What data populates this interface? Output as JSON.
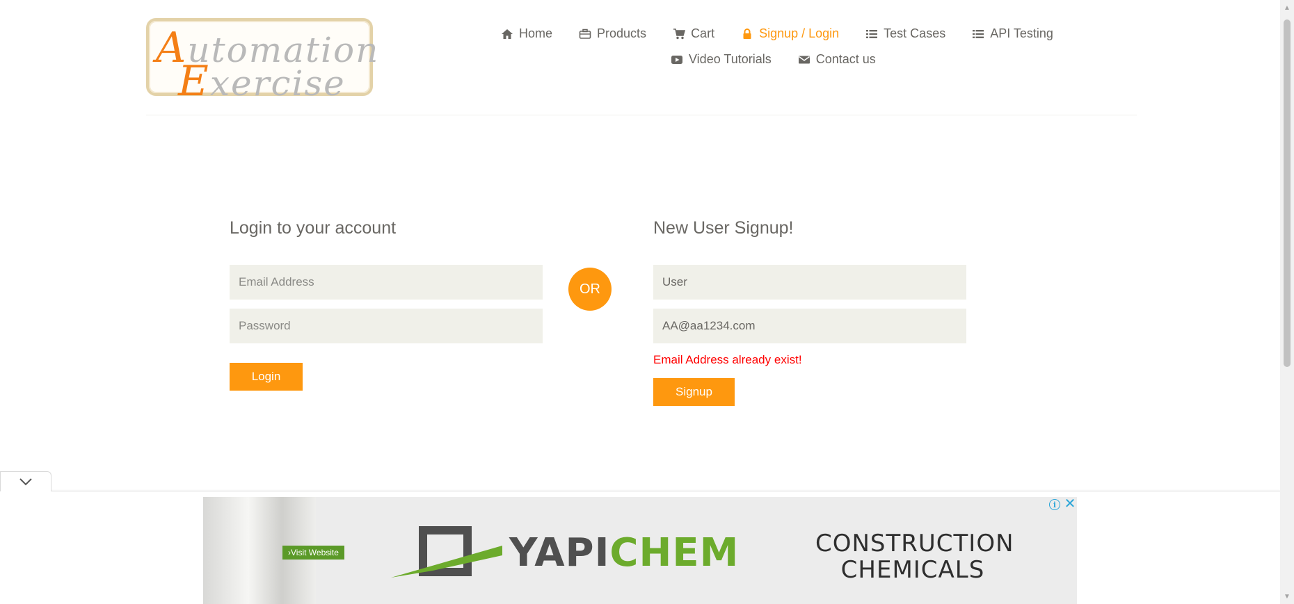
{
  "logo": {
    "line1_cap": "A",
    "line1_rest": "utomation",
    "line2_cap": "E",
    "line2_rest": "xercise"
  },
  "nav": {
    "row1": [
      {
        "label": "Home",
        "icon": "home-icon"
      },
      {
        "label": "Products",
        "icon": "briefcase-icon"
      },
      {
        "label": "Cart",
        "icon": "cart-icon"
      },
      {
        "label": "Signup / Login",
        "icon": "lock-icon",
        "active": true
      },
      {
        "label": "Test Cases",
        "icon": "list-icon"
      },
      {
        "label": "API Testing",
        "icon": "list-icon"
      }
    ],
    "row2": [
      {
        "label": "Video Tutorials",
        "icon": "youtube-icon"
      },
      {
        "label": "Contact us",
        "icon": "envelope-icon"
      }
    ]
  },
  "login": {
    "title": "Login to your account",
    "email_placeholder": "Email Address",
    "password_placeholder": "Password",
    "button": "Login"
  },
  "or_label": "OR",
  "signup": {
    "title": "New User Signup!",
    "name_value": "User",
    "email_value": "AA@aa1234.com",
    "error": "Email Address already exist!",
    "button": "Signup"
  },
  "ad": {
    "visit": "›Visit Website",
    "brand_part1": "YAPI",
    "brand_part2": "CHEM",
    "tagline_line1": "CONSTRUCTION",
    "tagline_line2": "CHEMICALS",
    "info": "i",
    "close": "✕"
  },
  "colors": {
    "accent": "#fe980f",
    "text": "#696763",
    "field_bg": "#f0f0e9",
    "error": "#ff0000"
  }
}
